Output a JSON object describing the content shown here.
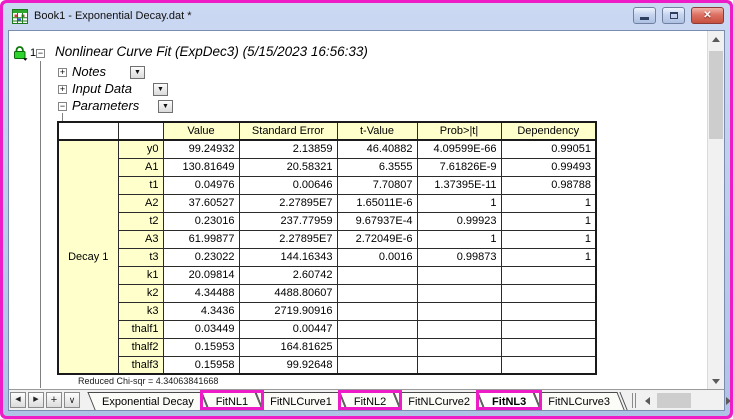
{
  "window": {
    "title": "Book1 - Exponential Decay.dat *",
    "close_glyph": "✕"
  },
  "report": {
    "node_number": "1",
    "node_toggle": "−",
    "title": "Nonlinear Curve Fit (ExpDec3) (5/15/2023 16:56:33)",
    "sections": [
      {
        "label": "Notes",
        "toggle": "+"
      },
      {
        "label": "Input Data",
        "toggle": "+"
      },
      {
        "label": "Parameters",
        "toggle": "−"
      }
    ],
    "dropdown_glyph": "▼",
    "footer_stat": "Reduced Chi-sqr = 4.34063841668"
  },
  "table": {
    "group_label": "Decay 1",
    "columns": [
      "Value",
      "Standard Error",
      "t-Value",
      "Prob>|t|",
      "Dependency"
    ],
    "rows": [
      {
        "param": "y0",
        "value": "99.24932",
        "std_error": "2.13859",
        "t_value": "46.40882",
        "prob": "4.09599E-66",
        "dependency": "0.99051"
      },
      {
        "param": "A1",
        "value": "130.81649",
        "std_error": "20.58321",
        "t_value": "6.3555",
        "prob": "7.61826E-9",
        "dependency": "0.99493"
      },
      {
        "param": "t1",
        "value": "0.04976",
        "std_error": "0.00646",
        "t_value": "7.70807",
        "prob": "1.37395E-11",
        "dependency": "0.98788"
      },
      {
        "param": "A2",
        "value": "37.60527",
        "std_error": "2.27895E7",
        "t_value": "1.65011E-6",
        "prob": "1",
        "dependency": "1"
      },
      {
        "param": "t2",
        "value": "0.23016",
        "std_error": "237.77959",
        "t_value": "9.67937E-4",
        "prob": "0.99923",
        "dependency": "1"
      },
      {
        "param": "A3",
        "value": "61.99877",
        "std_error": "2.27895E7",
        "t_value": "2.72049E-6",
        "prob": "1",
        "dependency": "1"
      },
      {
        "param": "t3",
        "value": "0.23022",
        "std_error": "144.16343",
        "t_value": "0.0016",
        "prob": "0.99873",
        "dependency": "1"
      },
      {
        "param": "k1",
        "value": "20.09814",
        "std_error": "2.60742",
        "t_value": "",
        "prob": "",
        "dependency": ""
      },
      {
        "param": "k2",
        "value": "4.34488",
        "std_error": "4488.80607",
        "t_value": "",
        "prob": "",
        "dependency": ""
      },
      {
        "param": "k3",
        "value": "4.3436",
        "std_error": "2719.90916",
        "t_value": "",
        "prob": "",
        "dependency": ""
      },
      {
        "param": "thalf1",
        "value": "0.03449",
        "std_error": "0.00447",
        "t_value": "",
        "prob": "",
        "dependency": ""
      },
      {
        "param": "thalf2",
        "value": "0.15953",
        "std_error": "164.81625",
        "t_value": "",
        "prob": "",
        "dependency": ""
      },
      {
        "param": "thalf3",
        "value": "0.15958",
        "std_error": "99.92648",
        "t_value": "",
        "prob": "",
        "dependency": ""
      }
    ]
  },
  "tab_bar": {
    "nav": {
      "prev": "◀",
      "next": "▶",
      "add": "+",
      "list": "∨"
    },
    "tabs": [
      {
        "label": "Exponential Decay",
        "highlighted": false,
        "active": false
      },
      {
        "label": "FitNL1",
        "highlighted": true,
        "active": false
      },
      {
        "label": "FitNLCurve1",
        "highlighted": false,
        "active": false
      },
      {
        "label": "FitNL2",
        "highlighted": true,
        "active": false
      },
      {
        "label": "FitNLCurve2",
        "highlighted": false,
        "active": false
      },
      {
        "label": "FitNL3",
        "highlighted": true,
        "active": true
      },
      {
        "label": "FitNLCurve3",
        "highlighted": false,
        "active": false
      }
    ]
  },
  "colors": {
    "highlight_magenta": "#ED1CC7",
    "titlebar_blue": "#B9C8EA",
    "cell_yellow": "#FFFFCC"
  }
}
